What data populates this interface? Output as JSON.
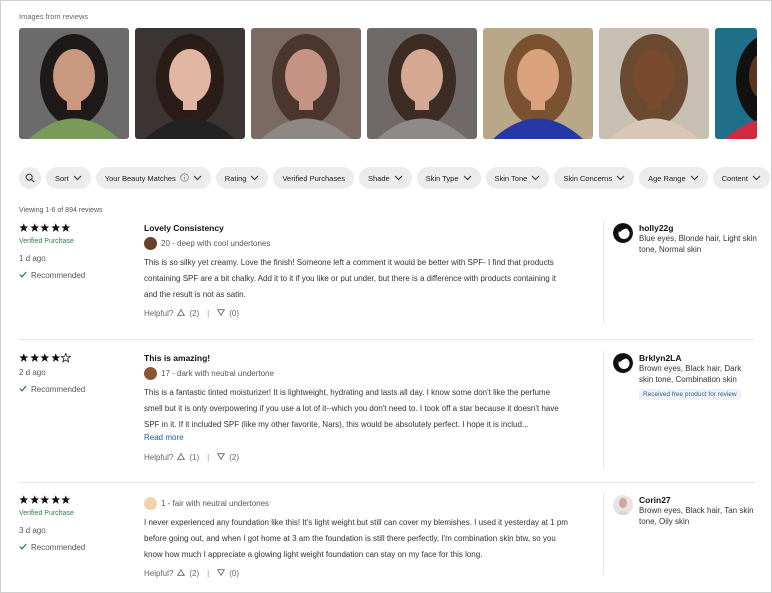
{
  "images_section": {
    "title": "Images from reviews",
    "thumbnails": [
      {
        "name": "review-photo-1",
        "colors": {
          "bg": "#6b6b6b",
          "skin": "#c9987e",
          "hair": "#1f1a1a",
          "cloth": "#7a9a5a"
        }
      },
      {
        "name": "review-photo-2",
        "colors": {
          "bg": "#3a3432",
          "skin": "#e0b5a2",
          "hair": "#2a1d18",
          "cloth": "#222222"
        }
      },
      {
        "name": "review-photo-3",
        "colors": {
          "bg": "#7a6a62",
          "skin": "#c49383",
          "hair": "#4a362c",
          "cloth": "#8d8884"
        }
      },
      {
        "name": "review-photo-4",
        "colors": {
          "bg": "#6f6a68",
          "skin": "#d4a892",
          "hair": "#3d2c24",
          "cloth": "#8e8a87"
        }
      },
      {
        "name": "review-photo-5",
        "colors": {
          "bg": "#b9a78a",
          "skin": "#d9a17c",
          "hair": "#7a5231",
          "cloth": "#2438a6"
        }
      },
      {
        "name": "review-photo-6",
        "colors": {
          "bg": "#c8bfb3",
          "skin": "#7a4a2e",
          "hair": "#6b4a32",
          "cloth": "#d8c7b6"
        }
      },
      {
        "name": "review-photo-7",
        "colors": {
          "bg": "#1f6f8a",
          "skin": "#5a3624",
          "hair": "#111111",
          "cloth": "#d02a3e"
        }
      }
    ]
  },
  "filters": {
    "search_icon": "magnifier",
    "chips": [
      {
        "label": "Sort",
        "has_info": false
      },
      {
        "label": "Your Beauty Matches",
        "has_info": true
      },
      {
        "label": "Rating",
        "has_info": false
      },
      {
        "label": "Verified Purchases",
        "has_info": false,
        "no_chevron": true
      },
      {
        "label": "Shade",
        "has_info": false
      },
      {
        "label": "Skin Type",
        "has_info": false
      },
      {
        "label": "Skin Tone",
        "has_info": false
      },
      {
        "label": "Skin Concerns",
        "has_info": false
      },
      {
        "label": "Age Range",
        "has_info": false
      },
      {
        "label": "Content",
        "has_info": false
      }
    ]
  },
  "viewing_text": "Viewing 1-6 of 894 reviews",
  "reviews": [
    {
      "rating": 5,
      "verified": "Verified Purchase",
      "date": "1 d ago",
      "recommended": "Recommended",
      "title": "Lovely Consistency",
      "shade_color": "#6b4028",
      "shade": "20 - deep with cool undertones",
      "body": "This is so silky yet creamy. Love the finish! Someone left a comment it would be better with SPF- I find that products containing SPF are a bit chalky. Add it to it if you like or put under, but there is a difference with products containing it and the result is not as satin.",
      "read_more": "",
      "helpful_label": "Helpful?",
      "helpful_yes": "(2)",
      "helpful_no": "(0)",
      "user": {
        "name": "holly22g",
        "attrs": "Blue eyes, Blonde hair, Light skin tone, Normal skin",
        "badge": ""
      }
    },
    {
      "rating": 4,
      "verified": "",
      "date": "2 d ago",
      "recommended": "Recommended",
      "title": "This is amazing!",
      "shade_color": "#8a5634",
      "shade": "17 - dark with neutral undertone",
      "body": "This is a fantastic tinted moisturizer! It is lightweight, hydrating and lasts all day. I know some don't like the perfume smell but it is only overpowering if you use a lot of it--which you don't need to. I took off a star because it doesn't have SPF in it. If it included SPF (like my other favorite, Nars), this would be absolutely perfect. I hope it is includ...",
      "read_more": "Read more",
      "helpful_label": "Helpful?",
      "helpful_yes": "(1)",
      "helpful_no": "(2)",
      "user": {
        "name": "Brklyn2LA",
        "attrs": "Brown eyes, Black hair, Dark skin tone, Combination skin",
        "badge": "Received free product for review"
      }
    },
    {
      "rating": 5,
      "verified": "Verified Purchase",
      "date": "3 d ago",
      "recommended": "Recommended",
      "title": "",
      "shade_color": "#f2d2ac",
      "shade": "1 - fair with neutral undertones",
      "body": "I never experienced any foundation like this!  It's light weight but still can cover my blemishes. I used it yesterday at 1 pm before going out,  and when I got home at 3 am the foundation is still there perfectly,  I'm combination skin btw,  so you know how much I appreciate a glowing light weight foundation can stay on my face for this long.",
      "read_more": "",
      "helpful_label": "Helpful?",
      "helpful_yes": "(2)",
      "helpful_no": "(0)",
      "user": {
        "name": "Corin27",
        "attrs": "Brown eyes, Black hair, Tan skin tone, Oily skin",
        "badge": ""
      }
    }
  ]
}
